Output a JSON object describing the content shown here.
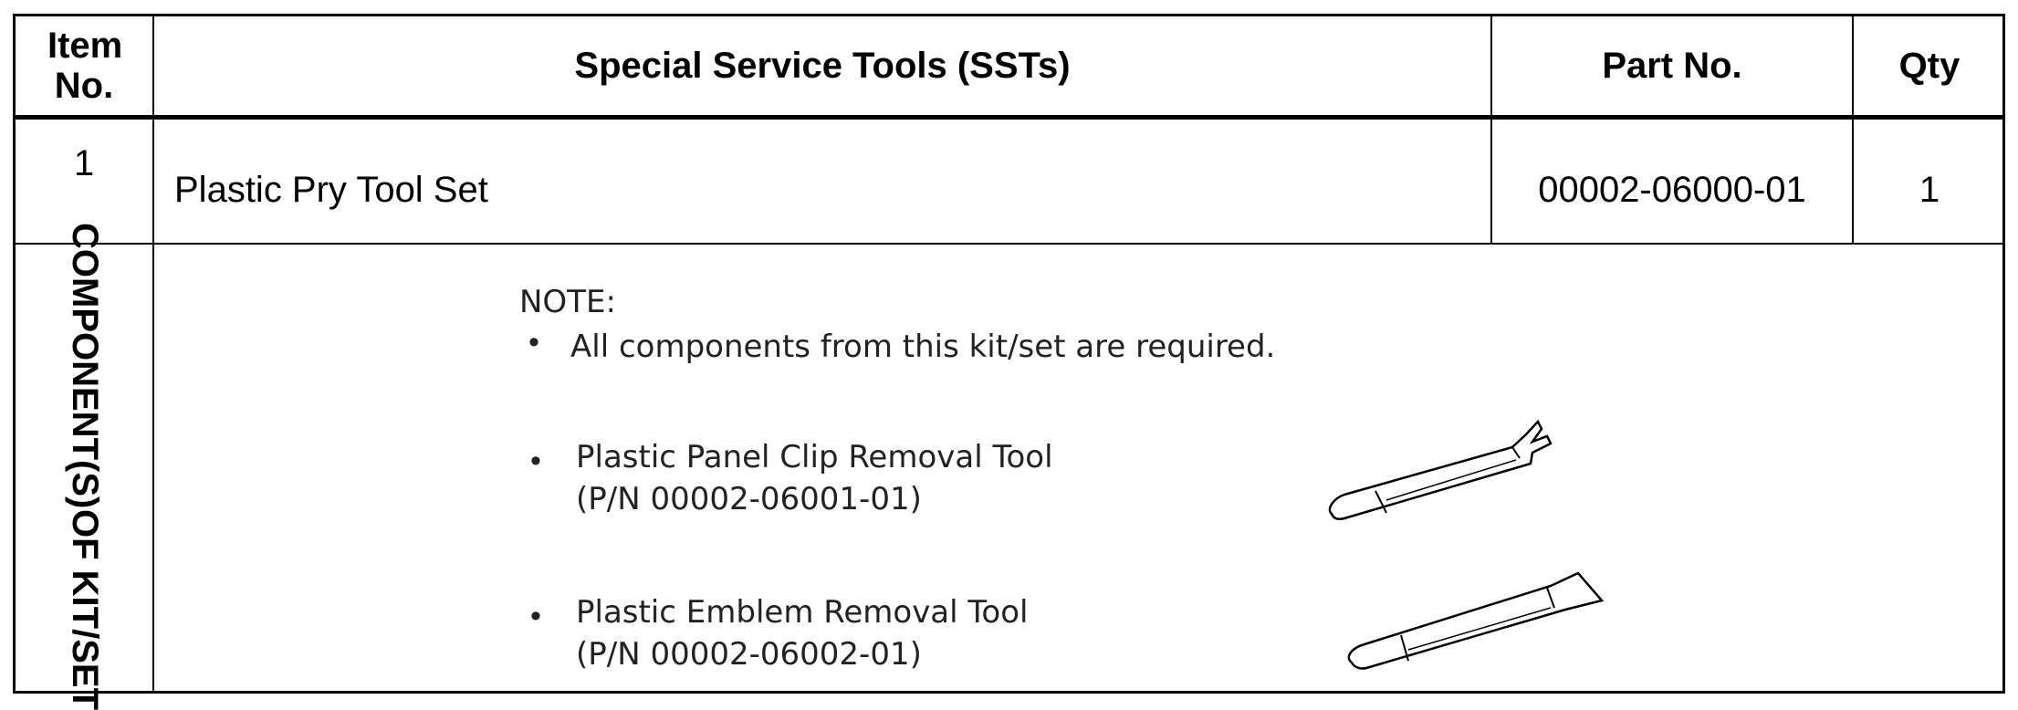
{
  "table": {
    "headers": {
      "item_no": "Item No.",
      "tools": "Special Service Tools (SSTs)",
      "part_no": "Part No.",
      "qty": "Qty"
    },
    "row1": {
      "item_no": "1",
      "tool": "Plastic Pry Tool Set",
      "part_no": "00002-06000-01",
      "qty": "1"
    },
    "components": {
      "side_label_line1": "COMPONENT(S)",
      "side_label_line2": "OF KIT/SET",
      "note_title": "NOTE:",
      "note_item": "All components from this kit/set are required.",
      "items": [
        {
          "name": "Plastic Panel Clip Removal Tool",
          "part": "(P/N 00002-06001-01)",
          "icon": "panel-clip-removal-tool-icon"
        },
        {
          "name": "Plastic Emblem Removal Tool",
          "part": "(P/N 00002-06002-01)",
          "icon": "emblem-removal-tool-icon"
        }
      ]
    }
  }
}
